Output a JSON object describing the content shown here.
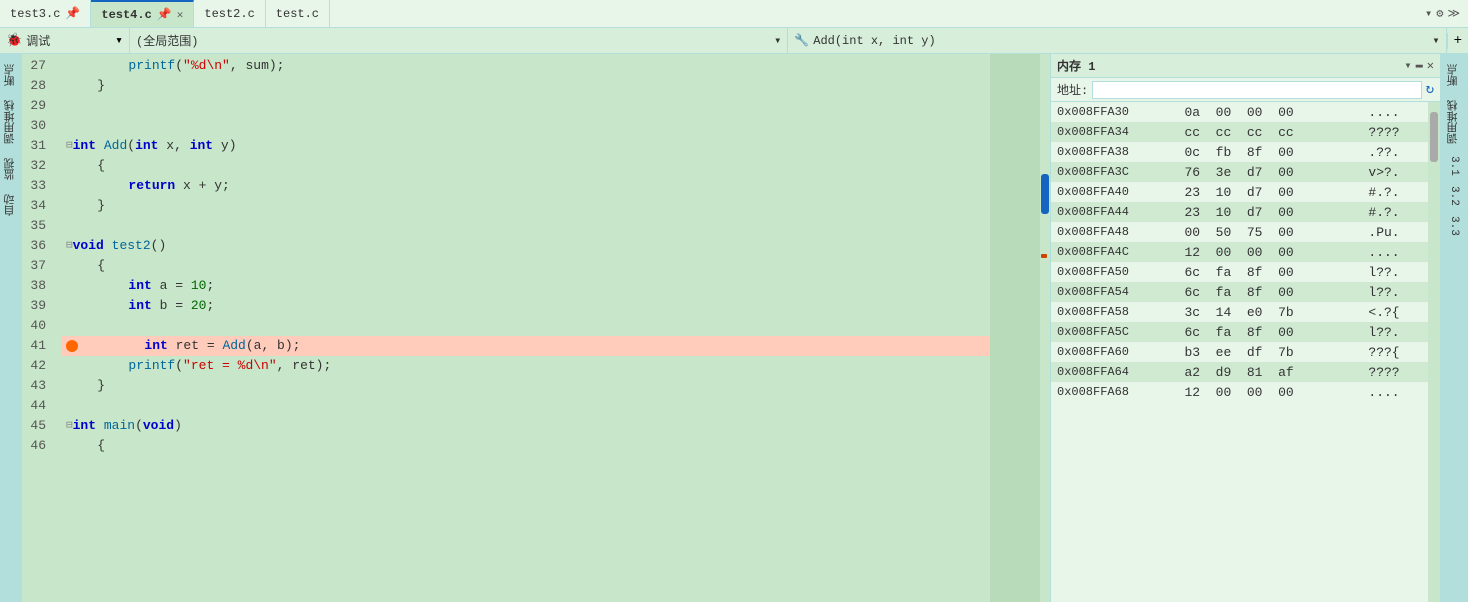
{
  "tabs": [
    {
      "label": "test3.c",
      "icon": "📄",
      "active": false,
      "closable": false
    },
    {
      "label": "test4.c",
      "active": true,
      "closable": true
    },
    {
      "label": "test2.c",
      "active": false,
      "closable": false
    },
    {
      "label": "test.c",
      "active": false,
      "closable": false
    }
  ],
  "toolbar": {
    "debug_label": "调试",
    "scope_label": "(全局范围)",
    "function_label": "Add(int x, int y)",
    "plus_icon": "+"
  },
  "left_sidebar": {
    "items": [
      "断",
      "点",
      "调",
      "用",
      "堆",
      "栈",
      "监",
      "视",
      "自",
      "动"
    ]
  },
  "right_sidebar": {
    "items": [
      "断",
      "点",
      "调",
      "用",
      "堆",
      "栈",
      "监",
      "视"
    ]
  },
  "code_lines": [
    {
      "num": 27,
      "indent": "        ",
      "content": "printf(\"%d\\n\", sum);",
      "type": "normal"
    },
    {
      "num": 28,
      "indent": "    ",
      "content": "}",
      "type": "normal"
    },
    {
      "num": 29,
      "indent": "",
      "content": "",
      "type": "normal"
    },
    {
      "num": 30,
      "indent": "",
      "content": "",
      "type": "normal"
    },
    {
      "num": 31,
      "indent": "",
      "content": "⊟int Add(int x, int y)",
      "type": "collapse",
      "has_marker": true
    },
    {
      "num": 32,
      "indent": "    ",
      "content": "{",
      "type": "normal"
    },
    {
      "num": 33,
      "indent": "        ",
      "content": "return x + y;",
      "type": "normal"
    },
    {
      "num": 34,
      "indent": "    ",
      "content": "}",
      "type": "normal"
    },
    {
      "num": 35,
      "indent": "",
      "content": "",
      "type": "normal"
    },
    {
      "num": 36,
      "indent": "",
      "content": "⊟void test2()",
      "type": "collapse",
      "has_marker": true
    },
    {
      "num": 37,
      "indent": "    ",
      "content": "{",
      "type": "normal"
    },
    {
      "num": 38,
      "indent": "        ",
      "content": "int a = 10;",
      "type": "normal"
    },
    {
      "num": 39,
      "indent": "        ",
      "content": "int b = 20;",
      "type": "normal"
    },
    {
      "num": 40,
      "indent": "",
      "content": "",
      "type": "normal"
    },
    {
      "num": 41,
      "indent": "        ",
      "content": "int ret = Add(a, b);",
      "type": "breakpoint"
    },
    {
      "num": 42,
      "indent": "        ",
      "content": "printf(\"ret = %d\\n\", ret);",
      "type": "normal"
    },
    {
      "num": 43,
      "indent": "    ",
      "content": "}",
      "type": "normal"
    },
    {
      "num": 44,
      "indent": "",
      "content": "",
      "type": "normal"
    },
    {
      "num": 45,
      "indent": "",
      "content": "⊟int main(void)",
      "type": "collapse",
      "has_marker": true
    },
    {
      "num": 46,
      "indent": "    ",
      "content": "{",
      "type": "normal"
    }
  ],
  "memory": {
    "title": "内存 1",
    "address_label": "地址:",
    "address_placeholder": "",
    "rows": [
      {
        "addr": "0x008FFA30",
        "b1": "0a",
        "b2": "00",
        "b3": "00",
        "b4": "00",
        "chars": "...."
      },
      {
        "addr": "0x008FFA34",
        "b1": "cc",
        "b2": "cc",
        "b3": "cc",
        "b4": "cc",
        "chars": "????"
      },
      {
        "addr": "0x008FFA38",
        "b1": "0c",
        "b2": "fb",
        "b3": "8f",
        "b4": "00",
        "chars": ".??."
      },
      {
        "addr": "0x008FFA3C",
        "b1": "76",
        "b2": "3e",
        "b3": "d7",
        "b4": "00",
        "chars": "v>?."
      },
      {
        "addr": "0x008FFA40",
        "b1": "23",
        "b2": "10",
        "b3": "d7",
        "b4": "00",
        "chars": "#.?."
      },
      {
        "addr": "0x008FFA44",
        "b1": "23",
        "b2": "10",
        "b3": "d7",
        "b4": "00",
        "chars": "#.?."
      },
      {
        "addr": "0x008FFA48",
        "b1": "00",
        "b2": "50",
        "b3": "75",
        "b4": "00",
        "chars": ".Pu."
      },
      {
        "addr": "0x008FFA4C",
        "b1": "12",
        "b2": "00",
        "b3": "00",
        "b4": "00",
        "chars": "...."
      },
      {
        "addr": "0x008FFA50",
        "b1": "6c",
        "b2": "fa",
        "b3": "8f",
        "b4": "00",
        "chars": "l??."
      },
      {
        "addr": "0x008FFA54",
        "b1": "6c",
        "b2": "fa",
        "b3": "8f",
        "b4": "00",
        "chars": "l??."
      },
      {
        "addr": "0x008FFA58",
        "b1": "3c",
        "b2": "14",
        "b3": "e0",
        "b4": "7b",
        "chars": "<.?{"
      },
      {
        "addr": "0x008FFA5C",
        "b1": "6c",
        "b2": "fa",
        "b3": "8f",
        "b4": "00",
        "chars": "l??."
      },
      {
        "addr": "0x008FFA60",
        "b1": "b3",
        "b2": "ee",
        "b3": "df",
        "b4": "7b",
        "chars": "???{"
      },
      {
        "addr": "0x008FFA64",
        "b1": "a2",
        "b2": "d9",
        "b3": "81",
        "b4": "af",
        "chars": "????"
      },
      {
        "addr": "0x008FFA68",
        "b1": "12",
        "b2": "00",
        "b3": "00",
        "b4": "00",
        "chars": "...."
      }
    ]
  },
  "right_panel_labels": [
    "3.1",
    "3.2",
    "3.3"
  ]
}
